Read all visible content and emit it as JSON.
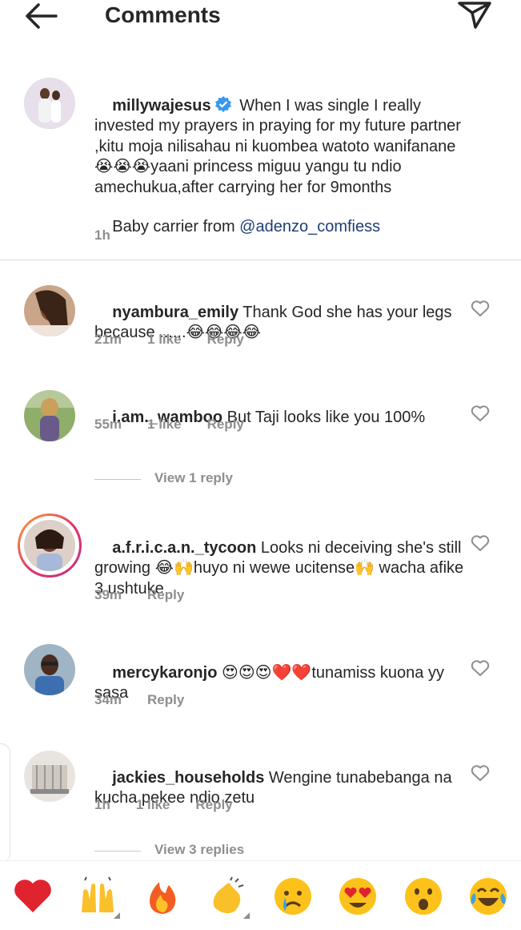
{
  "header": {
    "title": "Comments",
    "back_icon": "arrow-left-icon",
    "share_icon": "paper-plane-icon"
  },
  "caption": {
    "username": "millywajesus",
    "verified": true,
    "text": " When I was single I really invested my prayers in praying for my future partner ,kitu moja nilisahau ni kuombea watoto wanifanane😭😭😭yaani princess miguu yangu tu ndio amechukua,after carrying her for 9months",
    "text2_prefix": "Baby carrier from ",
    "mention": "@adenzo_comfiess",
    "time": "1h"
  },
  "comments": [
    {
      "username": "nyambura_emily",
      "text": " Thank God she has your legs because ......😂😂😂😂",
      "time": "21m",
      "likes": "1 like",
      "reply": "Reply"
    },
    {
      "username": "i.am._wamboo",
      "text": " But Taji looks like you 100%",
      "time": "55m",
      "likes": "1 like",
      "reply": "Reply",
      "view_replies": "View 1 reply"
    },
    {
      "username": "a.f.r.i.c.a.n._tycoon",
      "text": " Looks ni deceiving she's still growing 😂🙌huyo ni wewe ucitense🙌 wacha afike 3 ushtuke",
      "time": "39m",
      "reply": "Reply"
    },
    {
      "username": "mercykaronjo",
      "text": " 😍😍😍❤️❤️tunamiss kuona yy sasa",
      "time": "34m",
      "reply": "Reply"
    },
    {
      "username": "jackies_households",
      "text": " Wengine tunabebanga na kucha pekee ndio zetu",
      "time": "1h",
      "likes": "1 like",
      "reply": "Reply",
      "view_replies": "View 3 replies"
    }
  ],
  "emoji_bar": {
    "items": [
      "❤️",
      "🙌",
      "🔥",
      "👏",
      "😢",
      "😍",
      "😮",
      "😂"
    ]
  },
  "colors": {
    "text": "#262626",
    "meta": "#8e8e8e",
    "mention": "#1e3f75",
    "verified": "#3897f0",
    "story_ring": "#d6249f"
  }
}
